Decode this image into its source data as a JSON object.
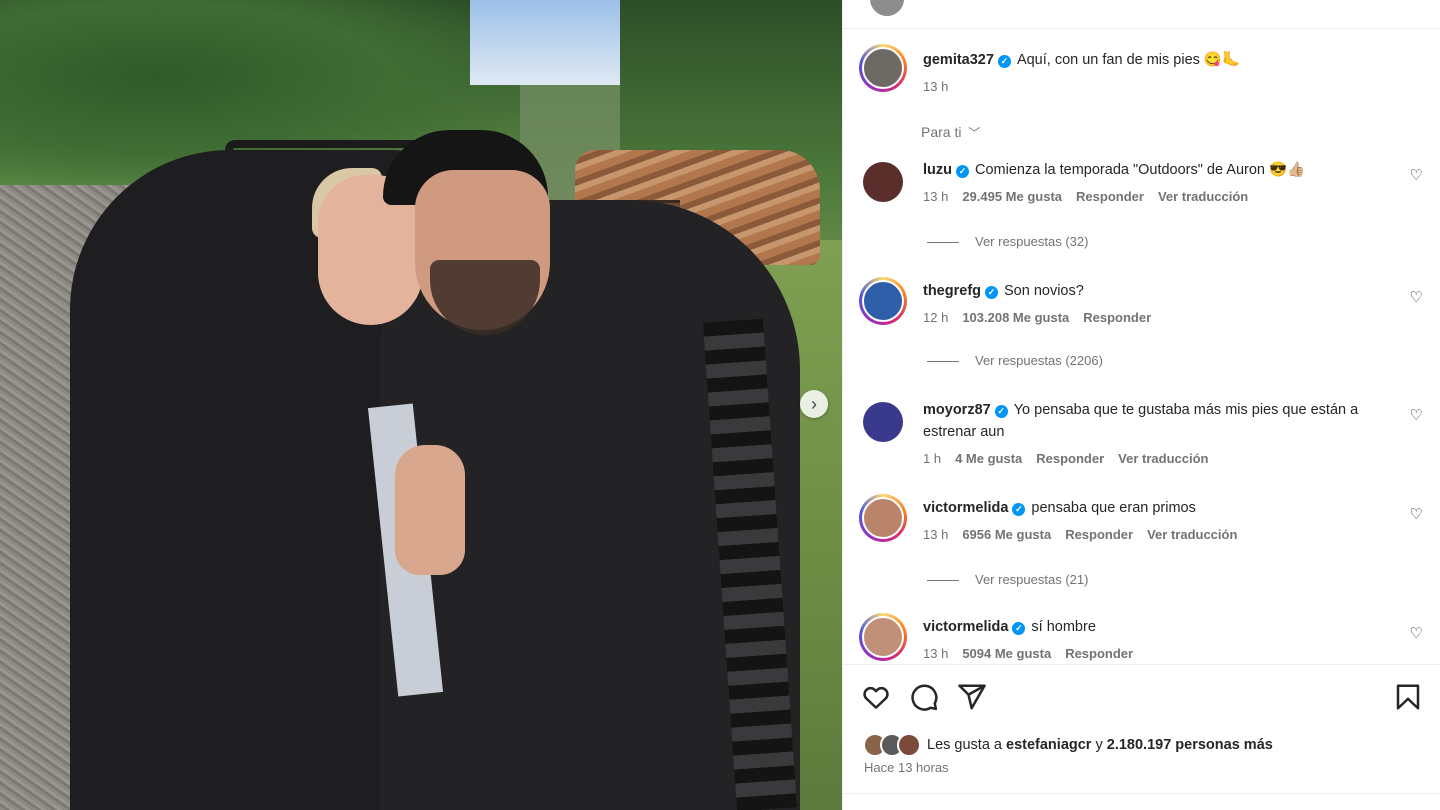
{
  "post": {
    "author": "gemita327",
    "caption": "Aquí, con un fan de mis pies 😋🦶",
    "time": "13 h"
  },
  "feed_filter": "Para ti",
  "comments": [
    {
      "user": "luzu",
      "text": "Comienza la temporada \"Outdoors\" de Auron 😎👍🏼",
      "time": "13 h",
      "likes": "29.495 Me gusta",
      "reply": "Responder",
      "translate": "Ver traducción",
      "replies": "Ver respuestas (32)"
    },
    {
      "user": "thegrefg",
      "text": "Son novios?",
      "time": "12 h",
      "likes": "103.208 Me gusta",
      "reply": "Responder",
      "translate": "",
      "replies": "Ver respuestas (2206)"
    },
    {
      "user": "moyorz87",
      "text": "Yo pensaba que te gustaba más mis pies que están a estrenar aun",
      "time": "1 h",
      "likes": "4 Me gusta",
      "reply": "Responder",
      "translate": "Ver traducción",
      "replies": ""
    },
    {
      "user": "victormelida",
      "text": "pensaba que eran primos",
      "time": "13 h",
      "likes": "6956 Me gusta",
      "reply": "Responder",
      "translate": "Ver traducción",
      "replies": "Ver respuestas (21)"
    },
    {
      "user": "victormelida",
      "text": "sí hombre",
      "time": "13 h",
      "likes": "5094 Me gusta",
      "reply": "Responder",
      "translate": "",
      "replies": ""
    }
  ],
  "likes": {
    "prefix": "Les gusta a",
    "first_user": "estefaniagcr",
    "connector": "y",
    "count": "2.180.197 personas más"
  },
  "posted_ago": "Hace 13 horas",
  "icons": [
    "heart-icon",
    "comment-icon",
    "share-icon",
    "bookmark-icon",
    "chevron-right-icon",
    "chevron-down-icon",
    "verified-icon"
  ]
}
